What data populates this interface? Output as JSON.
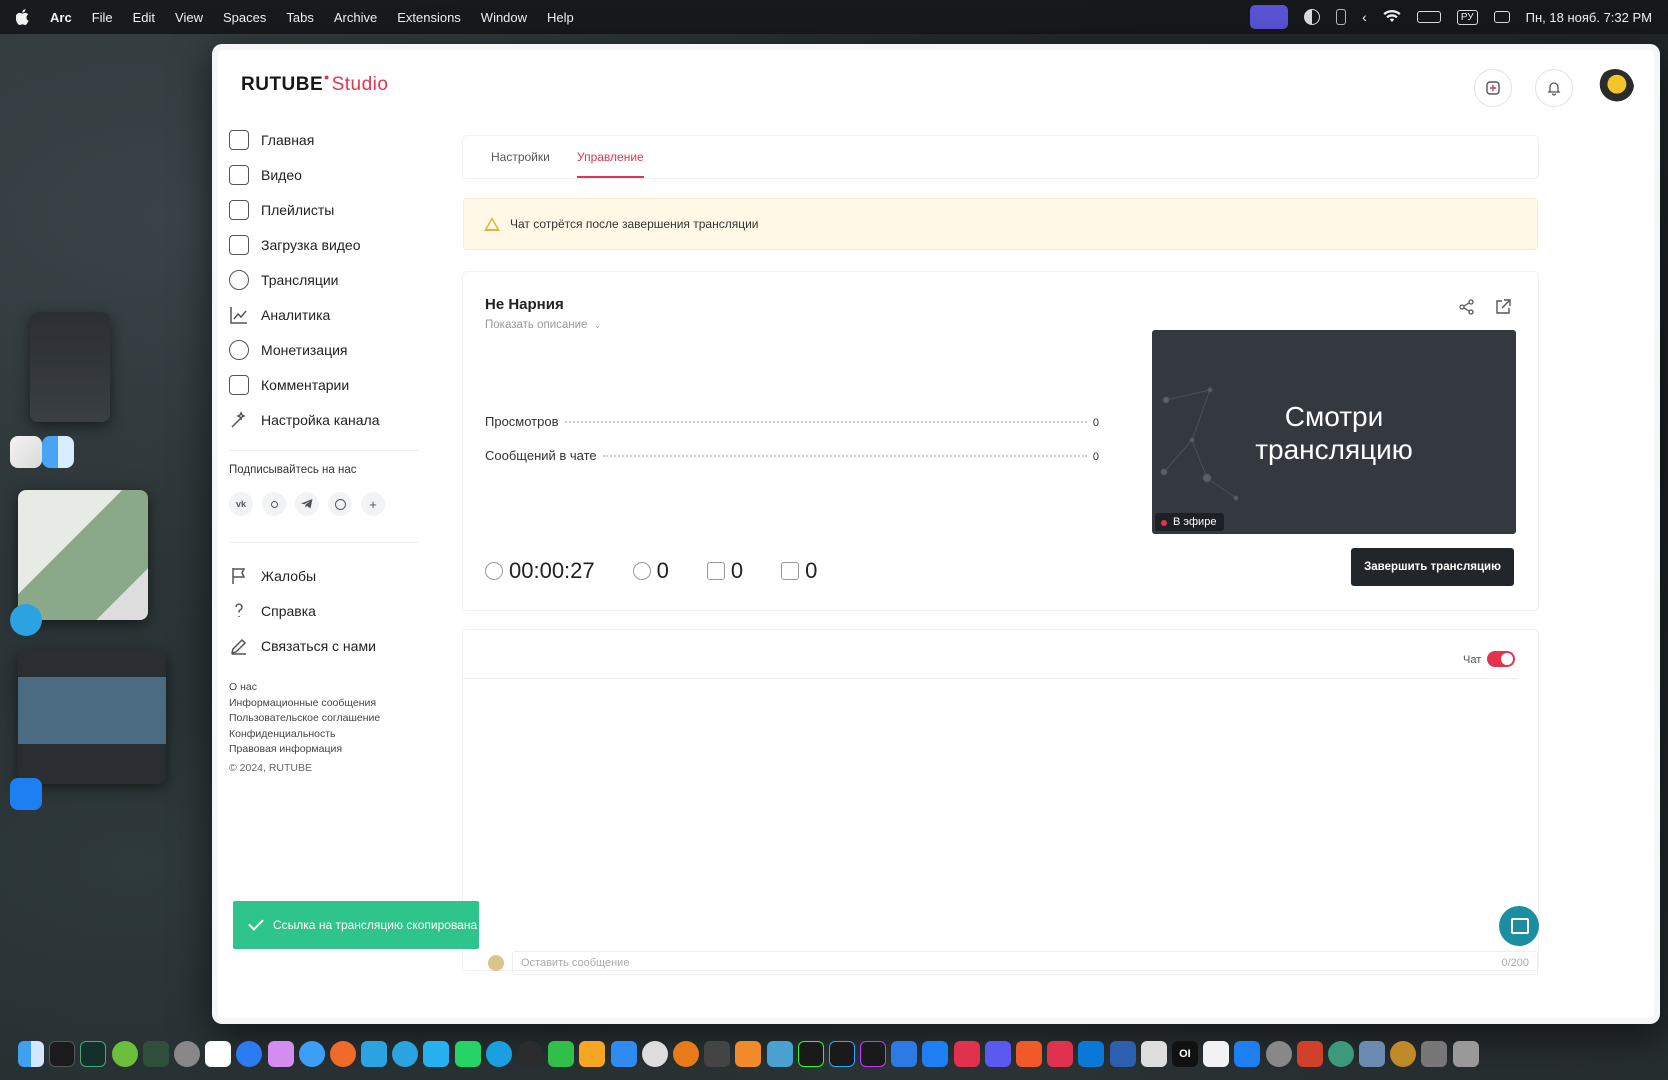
{
  "menubar": {
    "app_name": "Arc",
    "items": [
      "File",
      "Edit",
      "View",
      "Spaces",
      "Tabs",
      "Archive",
      "Extensions",
      "Window",
      "Help"
    ],
    "input_language": "РУ",
    "datetime": "Пн, 18 нояб. 7:32 PM"
  },
  "brand": {
    "logo_main": "RUTUBE",
    "logo_studio": "Studio",
    "accent_color": "#e4334d"
  },
  "sidebar": {
    "nav": [
      {
        "label": "Главная",
        "icon": "home-icon"
      },
      {
        "label": "Видео",
        "icon": "video-icon"
      },
      {
        "label": "Плейлисты",
        "icon": "playlist-icon"
      },
      {
        "label": "Загрузка видео",
        "icon": "upload-icon"
      },
      {
        "label": "Трансляции",
        "icon": "broadcast-icon"
      },
      {
        "label": "Аналитика",
        "icon": "analytics-icon"
      },
      {
        "label": "Монетизация",
        "icon": "monetization-icon"
      },
      {
        "label": "Комментарии",
        "icon": "comments-icon"
      },
      {
        "label": "Настройка канала",
        "icon": "wand-icon"
      }
    ],
    "follow_label": "Подписывайтесь на нас",
    "socials": [
      "vk",
      "ok",
      "telegram",
      "viber",
      "+"
    ],
    "support": [
      {
        "label": "Жалобы",
        "icon": "flag-icon"
      },
      {
        "label": "Справка",
        "icon": "help-icon"
      },
      {
        "label": "Связаться с нами",
        "icon": "edit-icon"
      }
    ],
    "footer_links": [
      "О нас",
      "Информационные сообщения",
      "Пользовательское соглашение",
      "Конфиденциальность",
      "Правовая информация"
    ],
    "copyright": "© 2024, RUTUBE"
  },
  "tabs": [
    {
      "label": "Настройки",
      "active": false
    },
    {
      "label": "Управление",
      "active": true
    }
  ],
  "alert": {
    "text": "Чат сотрётся после завершения трансляции"
  },
  "stream": {
    "title": "Не Нарния",
    "show_description": "Показать описание",
    "stats": [
      {
        "label": "Просмотров",
        "value": "0"
      },
      {
        "label": "Сообщений в чате",
        "value": "0"
      }
    ],
    "preview_text_line1": "Смотри",
    "preview_text_line2": "трансляцию",
    "live_badge": "В эфире",
    "duration": "00:00:27",
    "viewers": "0",
    "likes": "0",
    "dislikes": "0",
    "end_button": "Завершить трансляцию"
  },
  "chat": {
    "toggle_label": "Чат",
    "enabled": true,
    "input_placeholder": "Оставить сообщение",
    "char_counter": "0/200"
  },
  "toast": {
    "text": "Ссылка на трансляцию скопирована"
  }
}
